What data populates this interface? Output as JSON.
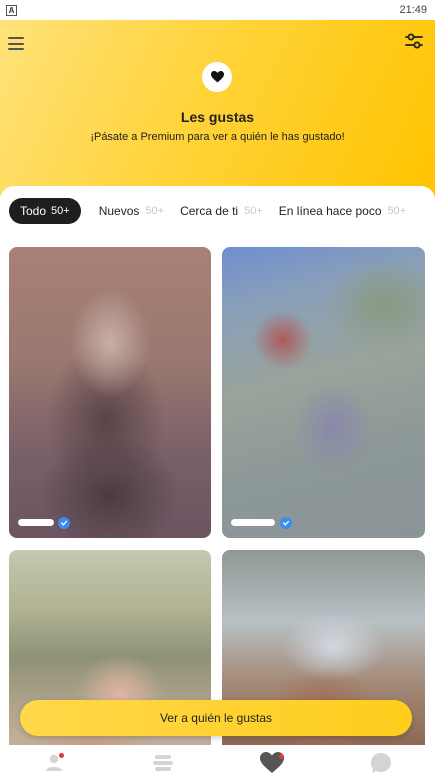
{
  "status_bar": {
    "notification_icon": "A",
    "time": "21:49"
  },
  "header": {
    "title": "Les gustas",
    "subtitle": "¡Pásate a Premium para ver a quién le has gustado!",
    "menu_icon": "menu-icon",
    "filter_icon": "sliders-icon",
    "badge_icon": "heart-icon",
    "gradient_colors": [
      "#ffe27a",
      "#ffd33a",
      "#ffc400"
    ]
  },
  "tabs": [
    {
      "label": "Todo",
      "count": "50+",
      "active": true
    },
    {
      "label": "Nuevos",
      "count": "50+",
      "active": false
    },
    {
      "label": "Cerca de ti",
      "count": "50+",
      "active": false
    },
    {
      "label": "En línea hace poco",
      "count": "50+",
      "active": false
    }
  ],
  "cards": [
    {
      "blurred": true,
      "verified": true
    },
    {
      "blurred": true,
      "verified": true
    },
    {
      "blurred": true,
      "verified": false
    },
    {
      "blurred": true,
      "verified": false
    }
  ],
  "cta": {
    "label": "Ver a quién le gustas",
    "color": "#ffd33a"
  },
  "bottom_nav": [
    {
      "icon": "profile-icon",
      "notification_dot": true,
      "active": false
    },
    {
      "icon": "discover-icon",
      "notification_dot": false,
      "active": false
    },
    {
      "icon": "likes-heart-icon",
      "notification_dot": true,
      "active": true
    },
    {
      "icon": "chat-icon",
      "notification_dot": false,
      "active": false
    }
  ],
  "colors": {
    "accent": "#ffc400",
    "active_tab": "#1e1e1e",
    "verified": "#3c8bf0",
    "notification_dot": "#e53935"
  }
}
